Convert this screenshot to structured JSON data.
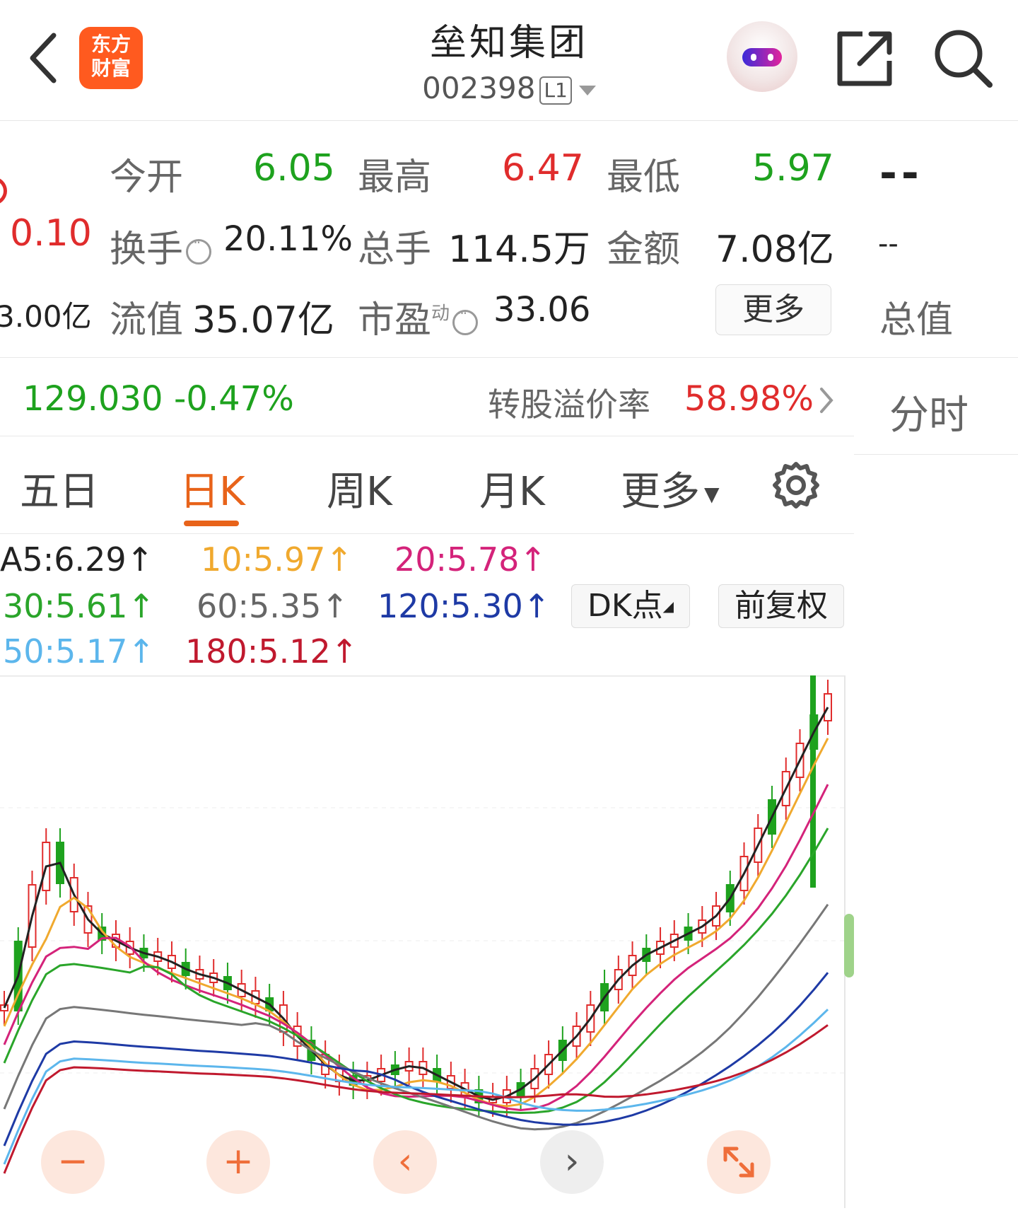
{
  "header": {
    "back_icon": "chevron-left-icon",
    "logo_line1": "东方",
    "logo_line2": "财富",
    "title": "垒知集团",
    "code": "002398",
    "level_badge": "L1",
    "share_icon": "share-icon",
    "search_icon": "search-icon"
  },
  "quote": {
    "left_change": "0.10",
    "left_cap": "3.00亿",
    "open_label": "今开",
    "open_value": "6.05",
    "high_label": "最高",
    "high_value": "6.47",
    "low_label": "最低",
    "low_value": "5.97",
    "turnover_label": "换手",
    "turnover_value": "20.11%",
    "volume_label": "总手",
    "volume_value": "114.5万",
    "amount_label": "金额",
    "amount_value": "7.08亿",
    "float_cap_label": "流值",
    "float_cap_value": "35.07亿",
    "pe_label": "市盈",
    "pe_superscript": "动",
    "pe_value": "33.06",
    "more_button": "更多",
    "right_dash1": "--",
    "right_dash2": "--",
    "right_total_label": "总值"
  },
  "convertible": {
    "price": "129.030",
    "change": "-0.47%",
    "premium_label": "转股溢价率",
    "premium_value": "58.98%"
  },
  "right_tab": "分时",
  "tabs": {
    "five_day": "五日",
    "day_k": "日K",
    "week_k": "周K",
    "month_k": "月K",
    "more": "更多"
  },
  "ma_legend": {
    "ma5": "A5:6.29",
    "ma10": "10:5.97",
    "ma20": "20:5.78",
    "ma30": "30:5.61",
    "ma60": "60:5.35",
    "ma120": "120:5.30",
    "ma250": "50:5.17",
    "ma180": "180:5.12",
    "arrow": "↑",
    "dk_button": "DK点",
    "adjust_button": "前复权"
  },
  "colors": {
    "up": "#e02c2c",
    "down": "#1ea21e",
    "accent": "#e8631a",
    "ma5": "#222222",
    "ma10": "#f0a92e",
    "ma20": "#d4237a",
    "ma30": "#2aa52a",
    "ma60": "#777777",
    "ma120": "#1e3aa5",
    "ma250": "#5cb6ec",
    "ma180": "#c0192e"
  },
  "controls": {
    "zoom_out": "−",
    "zoom_in": "+",
    "prev": "‹",
    "next": "›"
  }
}
